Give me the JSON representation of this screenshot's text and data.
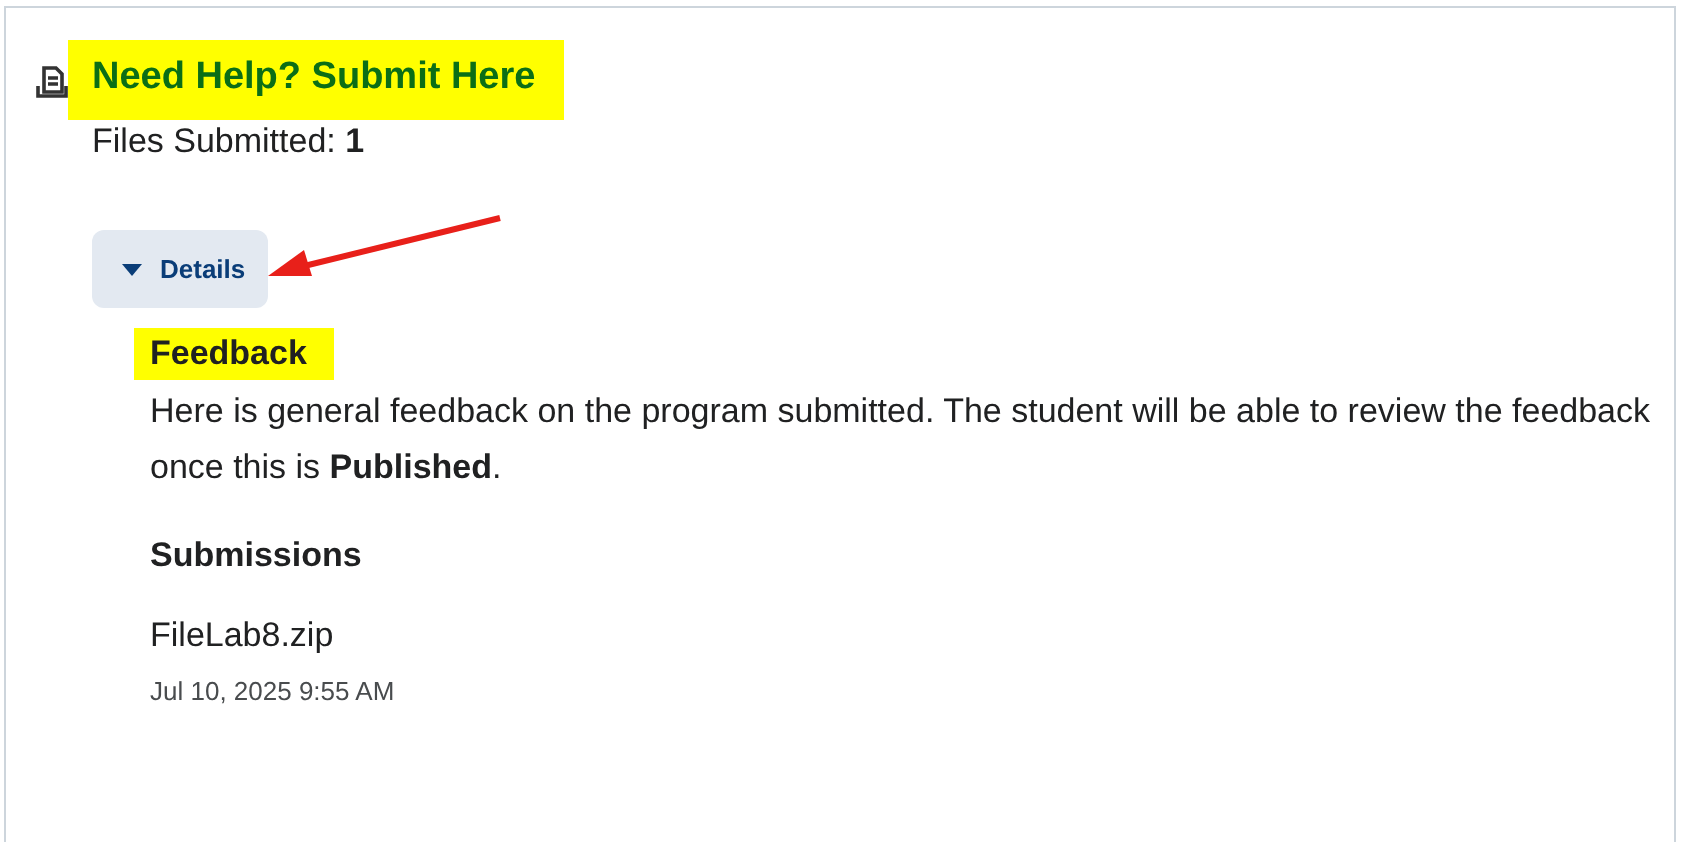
{
  "title": "Need Help? Submit Here",
  "files_submitted": {
    "label": "Files Submitted:",
    "count": "1"
  },
  "details": {
    "label": "Details",
    "expanded": true
  },
  "feedback": {
    "heading": "Feedback",
    "text": "Here is general feedback on the program submitted. The student will be able to review the feedback once this is **Published**."
  },
  "submissions": {
    "heading": "Submissions",
    "files": [
      {
        "name": "FileLab8.zip",
        "date": "Jul 10, 2025 9:55 AM"
      }
    ]
  }
}
